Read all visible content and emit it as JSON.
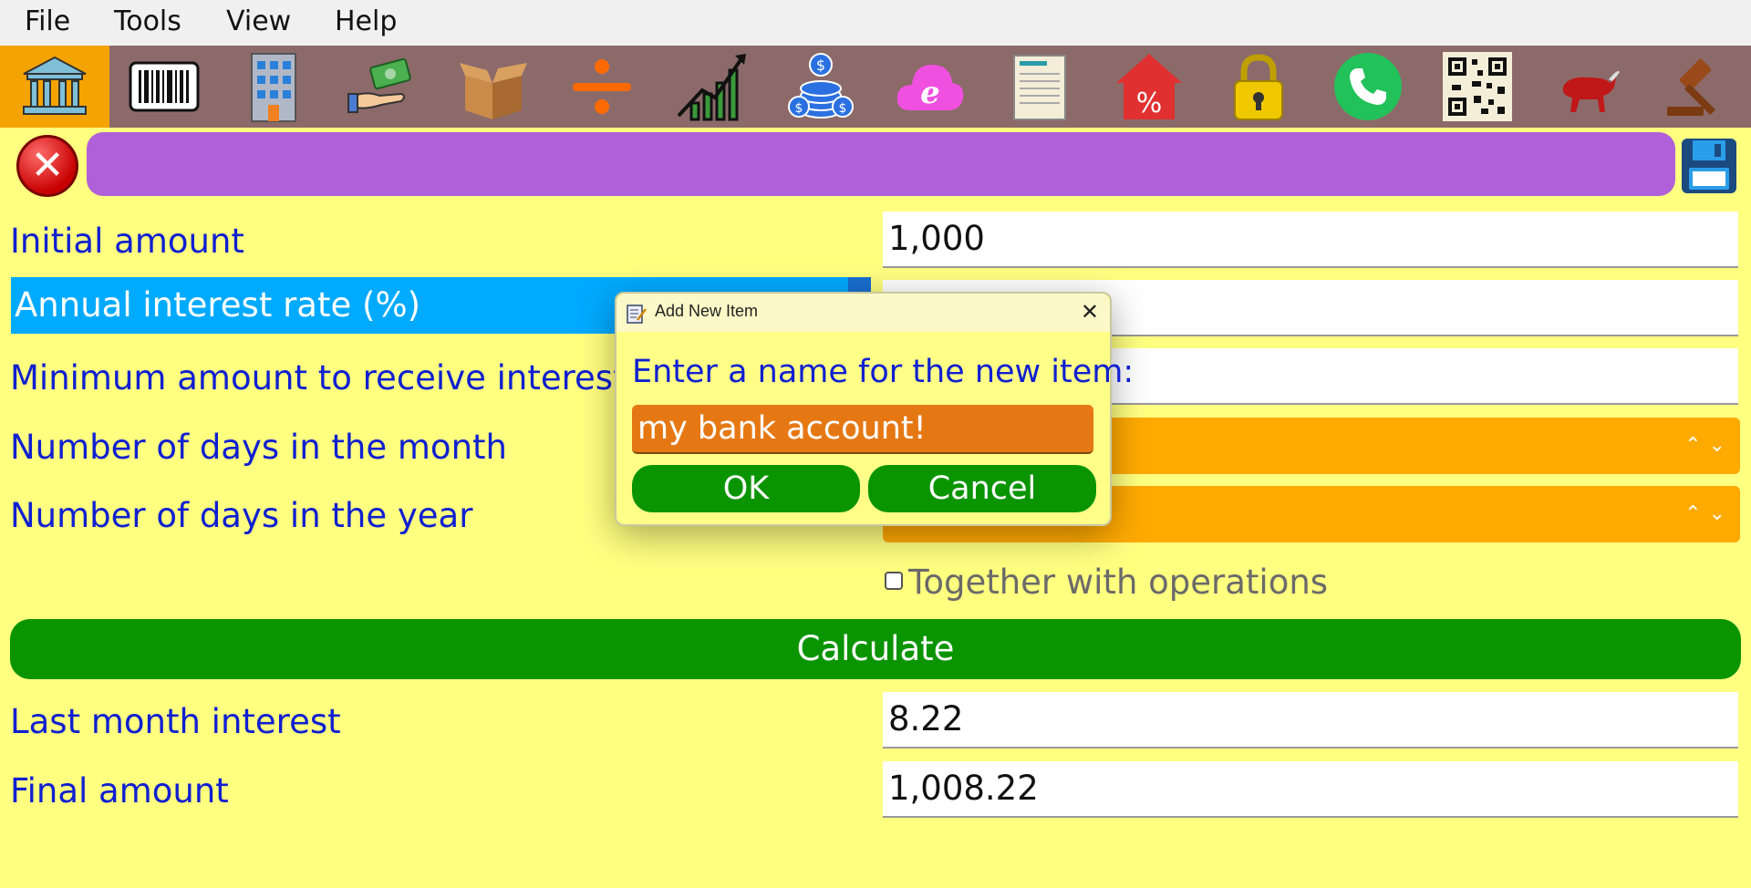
{
  "menu": {
    "file": "File",
    "tools": "Tools",
    "view": "View",
    "help": "Help"
  },
  "toolbar": {
    "items": [
      "bank-icon",
      "barcode-icon",
      "building-icon",
      "money-hand-icon",
      "box-icon",
      "divide-icon",
      "growth-chart-icon",
      "coins-icon",
      "cloud-browser-icon",
      "document-scroll-icon",
      "percent-house-icon",
      "padlock-icon",
      "phone-icon",
      "qr-code-icon",
      "bull-icon",
      "gavel-icon"
    ],
    "active_index": 0
  },
  "form": {
    "initial_amount": {
      "label": "Initial amount",
      "value": "1,000"
    },
    "annual_rate": {
      "label": "Annual interest rate (%)",
      "value": ""
    },
    "min_amount": {
      "label": "Minimum amount to receive interest",
      "value": ""
    },
    "days_month": {
      "label": "Number of days in the month",
      "value": ""
    },
    "days_year": {
      "label": "Number of days in the year",
      "value": ""
    },
    "together_ops": {
      "label": "Together with operations",
      "checked": false
    },
    "calculate": "Calculate",
    "last_month_interest": {
      "label": "Last month interest",
      "value": "8.22"
    },
    "final_amount": {
      "label": "Final amount",
      "value": "1,008.22"
    }
  },
  "dialog": {
    "title": "Add New Item",
    "prompt": "Enter a name for the new item:",
    "input_value": "my bank account!",
    "ok": "OK",
    "cancel": "Cancel"
  },
  "colors": {
    "background": "#ffff80",
    "toolbar": "#8c6a6a",
    "active_tool": "#f5a300",
    "name_bar": "#b060d8",
    "label_text": "#1020d0",
    "selected_row": "#00aaff",
    "combo": "#ffaa00",
    "button_green": "#0a9400",
    "dialog_input": "#e67814"
  }
}
